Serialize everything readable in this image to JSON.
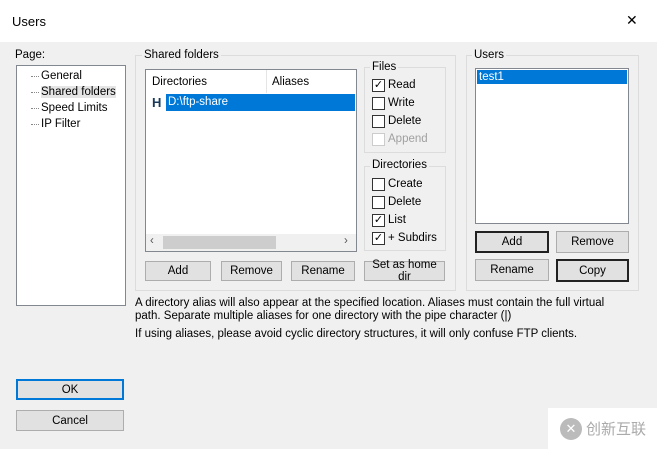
{
  "window": {
    "title": "Users",
    "close": "✕"
  },
  "page": {
    "label": "Page:",
    "items": [
      "General",
      "Shared folders",
      "Speed Limits",
      "IP Filter"
    ]
  },
  "shared": {
    "label": "Shared folders",
    "columns": [
      "Directories",
      "Aliases"
    ],
    "rows": [
      {
        "flag": "H",
        "dir": "D:\\ftp-share",
        "alias": ""
      }
    ],
    "buttons": [
      "Add",
      "Remove",
      "Rename",
      "Set as home dir"
    ]
  },
  "files": {
    "label": "Files",
    "items": [
      {
        "label": "Read",
        "checked": true
      },
      {
        "label": "Write",
        "checked": false
      },
      {
        "label": "Delete",
        "checked": false
      },
      {
        "label": "Append",
        "checked": false,
        "disabled": true
      }
    ]
  },
  "dirs": {
    "label": "Directories",
    "items": [
      {
        "label": "Create",
        "checked": false
      },
      {
        "label": "Delete",
        "checked": false
      },
      {
        "label": "List",
        "checked": true
      },
      {
        "label": "+ Subdirs",
        "checked": true
      }
    ]
  },
  "users": {
    "label": "Users",
    "items": [
      "test1"
    ],
    "buttons": [
      "Add",
      "Remove",
      "Rename",
      "Copy"
    ]
  },
  "info": {
    "line1": "A directory alias will also appear at the specified location. Aliases must contain the full virtual",
    "line2": "path. Separate multiple aliases for one directory with the pipe character (|)",
    "line3": "If using aliases, please avoid cyclic directory structures, it will only confuse FTP clients."
  },
  "dialog": {
    "ok": "OK",
    "cancel": "Cancel"
  },
  "watermark": "创新互联"
}
